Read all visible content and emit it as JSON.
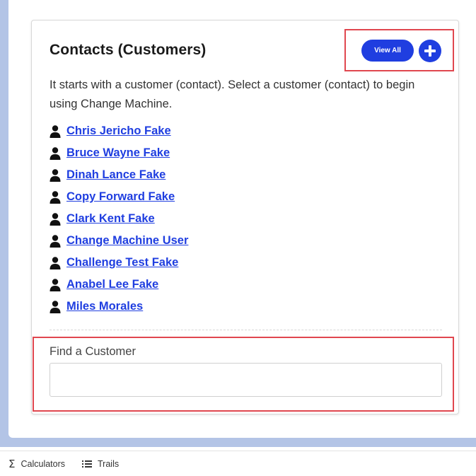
{
  "card": {
    "title": "Contacts (Customers)",
    "view_all_label": "View All",
    "intro": "It starts with a customer (contact). Select a customer (contact) to begin using Change Machine.",
    "contacts": [
      {
        "name": "Chris Jericho Fake"
      },
      {
        "name": "Bruce Wayne Fake"
      },
      {
        "name": "Dinah Lance Fake"
      },
      {
        "name": "Copy Forward Fake"
      },
      {
        "name": "Clark Kent Fake"
      },
      {
        "name": "Change Machine User"
      },
      {
        "name": "Challenge Test Fake"
      },
      {
        "name": "Anabel Lee Fake"
      },
      {
        "name": "Miles Morales"
      }
    ],
    "find_label": "Find a Customer",
    "find_value": ""
  },
  "bottom_bar": {
    "calculators_label": "Calculators",
    "trails_label": "Trails"
  },
  "icons": {
    "add": "plus-icon",
    "contact": "person-icon",
    "calculators": "sigma-icon",
    "trails": "list-icon"
  },
  "colors": {
    "accent": "#1f3ee0",
    "highlight": "#e0474f",
    "background": "#b3c4e6"
  }
}
